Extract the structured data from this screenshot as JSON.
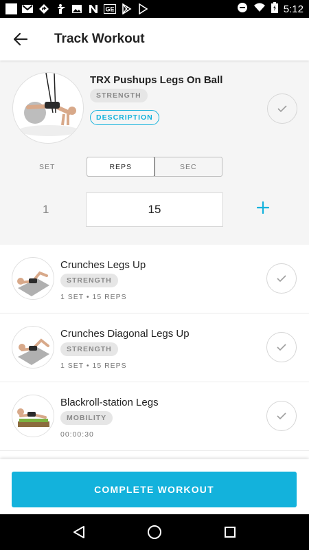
{
  "status_bar": {
    "time": "5:12",
    "icons": [
      "square-icon",
      "gmail-icon",
      "navigation-icon",
      "accessibility-icon",
      "image-icon",
      "n-app-icon",
      "ge-icon",
      "play-store-icon",
      "play-icon",
      "dnd-icon",
      "wifi-icon",
      "battery-icon"
    ]
  },
  "app_bar": {
    "title": "Track Workout",
    "back_icon": "arrow-left-icon"
  },
  "active_exercise": {
    "title": "TRX Pushups Legs On Ball",
    "category": "STRENGTH",
    "description_label": "DESCRIPTION",
    "set_label": "SET",
    "mode_reps_label": "REPS",
    "mode_sec_label": "SEC",
    "selected_mode": "REPS",
    "set_number": "1",
    "reps_value": "15"
  },
  "exercises": [
    {
      "name": "Crunches Legs Up",
      "category": "STRENGTH",
      "meta": "1 SET • 15 REPS"
    },
    {
      "name": "Crunches Diagonal Legs Up",
      "category": "STRENGTH",
      "meta": "1 SET • 15 REPS"
    },
    {
      "name": "Blackroll-station Legs",
      "category": "MOBILITY",
      "meta": "00:00:30"
    }
  ],
  "complete_button_label": "COMPLETE WORKOUT",
  "colors": {
    "accent": "#13b2dc",
    "chip_bg": "#e6e6e6",
    "active_bg": "#f5f5f5"
  }
}
